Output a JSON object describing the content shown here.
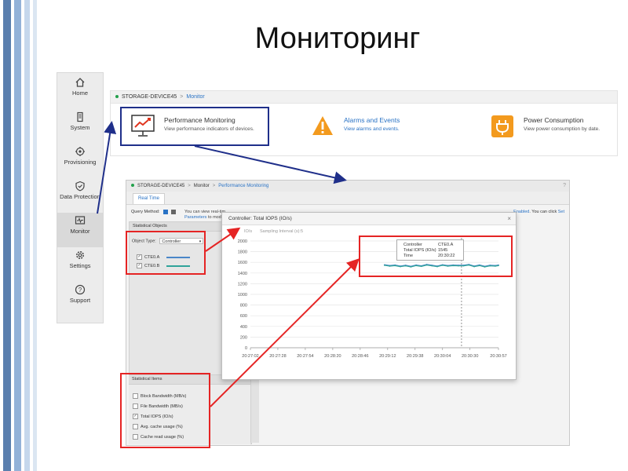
{
  "slide": {
    "title": "Мониторинг"
  },
  "theme": {
    "stripe_colors": [
      "#5a7fae",
      "#93b2d8",
      "#c5d7ec"
    ],
    "accent_blue": "#2a73c5",
    "status_green": "#22a04b",
    "highlight_red": "#e52424",
    "highlight_navy": "#1f2f8a",
    "warning_orange": "#f39a1e"
  },
  "sidebar": {
    "items": [
      {
        "label": "Home",
        "icon": "home-icon"
      },
      {
        "label": "System",
        "icon": "system-icon"
      },
      {
        "label": "Provisioning",
        "icon": "provisioning-icon"
      },
      {
        "label": "Data Protection",
        "icon": "shield-check-icon"
      },
      {
        "label": "Monitor",
        "icon": "monitor-pulse-icon",
        "active": true
      },
      {
        "label": "Settings",
        "icon": "gear-icon"
      },
      {
        "label": "Support",
        "icon": "help-icon"
      }
    ]
  },
  "top_panel": {
    "device": "STORAGE-DEVICE45",
    "separator": ">",
    "section": "Monitor",
    "cards": [
      {
        "title": "Performance Monitoring",
        "desc": "View performance indicators of devices.",
        "icon": "performance-chart-icon"
      },
      {
        "title": "Alarms and Events",
        "desc": "View alarms and events.",
        "icon": "warning-icon"
      },
      {
        "title": "Power Consumption",
        "desc": "View power consumption by date.",
        "icon": "power-plug-icon"
      }
    ]
  },
  "monitor_window": {
    "breadcrumb": {
      "device": "STORAGE-DEVICE45",
      "section": "Monitor",
      "page": "Performance Monitoring"
    },
    "help": "?",
    "tab": "Real Time",
    "query_method_label": "Query Method:",
    "query_text": "You can view real-tim",
    "query_text2": "Parameters",
    "query_text2_rest": " to modif",
    "query_text_right_blue": "Enabled",
    "query_text_right": ". You can click",
    "query_text_right_link": "Set",
    "statistical_objects": {
      "header": "Statistical Objects",
      "object_type_label": "Object Type:",
      "object_type_value": "Controller",
      "controllers": [
        {
          "name": "CTE0.A",
          "checked": true,
          "color": "#4a86c8"
        },
        {
          "name": "CTE0.B",
          "checked": true,
          "color": "#2fa39a"
        }
      ]
    },
    "statistical_items": {
      "header": "Statistical Items",
      "items": [
        {
          "label": "Block Bandwidth (MB/s)",
          "checked": false
        },
        {
          "label": "File Bandwidth (MB/s)",
          "checked": false
        },
        {
          "label": "Total IOPS (IO/s)",
          "checked": true
        },
        {
          "label": "Avg. cache usage (%)",
          "checked": false
        },
        {
          "label": "Cache read usage (%)",
          "checked": false
        }
      ]
    }
  },
  "chart_popup": {
    "title": "Controller: Total IOPS (IO/s)",
    "close": "×",
    "unit_label": "IO/s",
    "sampling_label": "Sampling Interval (s):5",
    "tooltip": [
      {
        "label": "Controller",
        "value": "CTE0.A"
      },
      {
        "label": "Total IOPS (IO/s)",
        "value": "1545"
      },
      {
        "label": "Time",
        "value": "20:30:22"
      }
    ]
  },
  "chart_data": {
    "type": "line",
    "title": "Controller: Total IOPS (IO/s)",
    "ylabel": "",
    "xlabel": "",
    "ylim": [
      0,
      2000
    ],
    "yticks": [
      0,
      200,
      400,
      600,
      800,
      1000,
      1200,
      1400,
      1600,
      1800,
      2000
    ],
    "xticks": [
      "20:27:02",
      "20:27:28",
      "20:27:54",
      "20:28:20",
      "20:28:46",
      "20:29:12",
      "20:29:38",
      "20:30:04",
      "20:30:30",
      "20:30:57"
    ],
    "grid": true,
    "series": [
      {
        "name": "CTE0.A",
        "color": "#4a86c8",
        "x": [
          "20:29:09",
          "20:29:14",
          "20:29:19",
          "20:29:24",
          "20:29:29",
          "20:29:34",
          "20:29:39",
          "20:29:44",
          "20:29:49",
          "20:29:54",
          "20:29:59",
          "20:30:04",
          "20:30:09",
          "20:30:14",
          "20:30:19",
          "20:30:24",
          "20:30:29",
          "20:30:34",
          "20:30:39",
          "20:30:44",
          "20:30:49",
          "20:30:54",
          "20:30:57"
        ],
        "values": [
          1555,
          1540,
          1550,
          1530,
          1545,
          1525,
          1550,
          1535,
          1560,
          1545,
          1530,
          1555,
          1540,
          1550,
          1545,
          1545,
          1560,
          1530,
          1550,
          1525,
          1545,
          1540,
          1550
        ]
      },
      {
        "name": "CTE0.B",
        "color": "#2fa39a",
        "x": [
          "20:29:09",
          "20:29:14",
          "20:29:19",
          "20:29:24",
          "20:29:29",
          "20:29:34",
          "20:29:39",
          "20:29:44",
          "20:29:49",
          "20:29:54",
          "20:29:59",
          "20:30:04",
          "20:30:09",
          "20:30:14",
          "20:30:19",
          "20:30:24",
          "20:30:29",
          "20:30:34",
          "20:30:39",
          "20:30:44",
          "20:30:49",
          "20:30:54",
          "20:30:57"
        ],
        "values": [
          1545,
          1530,
          1540,
          1520,
          1535,
          1515,
          1540,
          1525,
          1550,
          1535,
          1520,
          1545,
          1530,
          1540,
          1535,
          1535,
          1550,
          1520,
          1540,
          1515,
          1535,
          1530,
          1540
        ]
      }
    ],
    "cursor_time": "20:30:22"
  }
}
